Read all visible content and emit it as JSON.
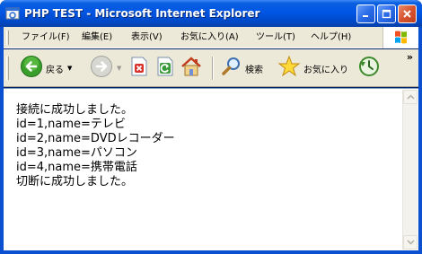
{
  "window": {
    "title": "PHP TEST - Microsoft Internet Explorer"
  },
  "menu": {
    "items": [
      {
        "label": "ファイル(F)"
      },
      {
        "label": "編集(E)"
      },
      {
        "label": "表示(V)"
      },
      {
        "label": "お気に入り(A)"
      },
      {
        "label": "ツール(T)"
      },
      {
        "label": "ヘルプ(H)"
      }
    ]
  },
  "toolbar": {
    "back_label": "戻る",
    "search_label": "検索",
    "favorites_label": "お気に入り",
    "more_chevron": "»"
  },
  "content": {
    "lines": [
      "接続に成功しました。",
      "id=1,name=テレビ",
      "id=2,name=DVDレコーダー",
      "id=3,name=パソコン",
      "id=4,name=携帯電話",
      "切断に成功しました。"
    ]
  },
  "colors": {
    "titlebar": "#0055e5",
    "chrome": "#ece9d8",
    "page_bg": "#ffffff"
  }
}
